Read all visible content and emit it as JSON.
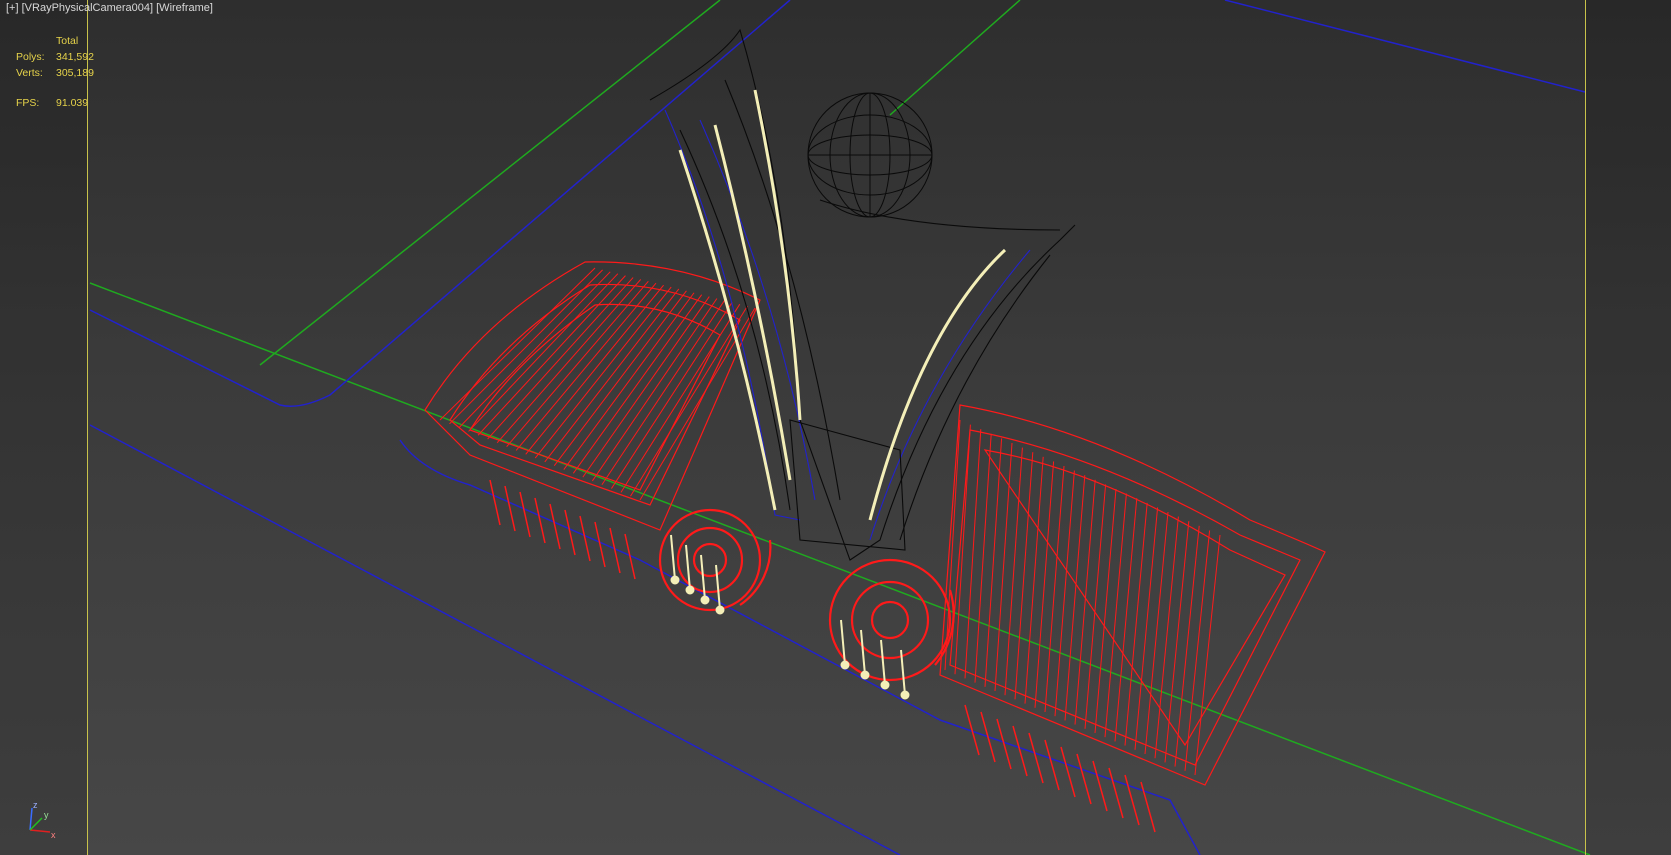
{
  "viewport": {
    "menu_plus": "[+]",
    "camera": "[VRayPhysicalCamera004]",
    "shading": "[Wireframe]"
  },
  "stats": {
    "header": "Total",
    "polys_label": "Polys:",
    "polys_value": "341,592",
    "verts_label": "Verts:",
    "verts_value": "305,189",
    "fps_label": "FPS:",
    "fps_value": "91.039"
  },
  "axis": {
    "x": "x",
    "y": "y",
    "z": "z"
  },
  "colors": {
    "background": "#3a3a3a",
    "safe_frame": "#c8c24a",
    "stats_text": "#e6d34a",
    "wire_red": "#ff1a1a",
    "wire_blue": "#2222cc",
    "wire_green": "#1faa1f",
    "wire_black": "#0a0a0a",
    "wire_cream": "#f4efb8"
  }
}
